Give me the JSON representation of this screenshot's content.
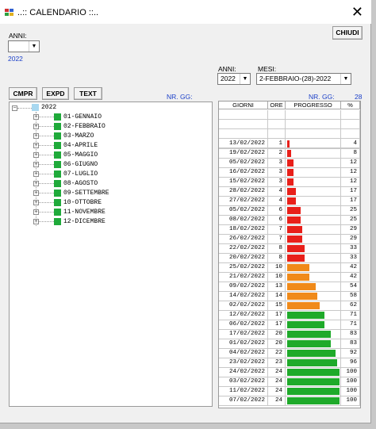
{
  "window": {
    "title": "..:: CALENDARIO ::..",
    "close_glyph": "✕"
  },
  "toolbar": {
    "chiudi_label": "CHIUDI",
    "cmpr_label": "CMPR",
    "expd_label": "EXPD",
    "text_label": "TEXT"
  },
  "filters": {
    "anni_label_left": "ANNI:",
    "anni_value_left": "",
    "year_text": "2022",
    "anni_label": "ANNI:",
    "anni_value": "2022",
    "mesi_label": "MESI:",
    "mesi_value": "2-FEBBRAIO-(28)-2022",
    "nr_gg_left": "NR. GG:",
    "nr_gg_right": "NR. GG:",
    "nr_gg_value": "28"
  },
  "tree": {
    "root": "2022",
    "months": [
      "01-GENNAIO",
      "02-FEBBRAIO",
      "03-MARZO",
      "04-APRILE",
      "05-MAGGIO",
      "06-GIUGNO",
      "07-LUGLIO",
      "08-AGOSTO",
      "09-SETTEMBRE",
      "10-OTTOBRE",
      "11-NOVEMBRE",
      "12-DICEMBRE"
    ],
    "colors": {
      "root": "#a8d8f0",
      "month": "#1faa3a"
    }
  },
  "grid": {
    "headers": [
      "GIORNI",
      "ORE",
      "PROGRESSO",
      "%"
    ],
    "rows": [
      {
        "date": "13/02/2022",
        "ore": "1",
        "pct": "4"
      },
      {
        "date": "19/02/2022",
        "ore": "2",
        "pct": "8"
      },
      {
        "date": "05/02/2022",
        "ore": "3",
        "pct": "12"
      },
      {
        "date": "16/02/2022",
        "ore": "3",
        "pct": "12"
      },
      {
        "date": "15/02/2022",
        "ore": "3",
        "pct": "12"
      },
      {
        "date": "28/02/2022",
        "ore": "4",
        "pct": "17"
      },
      {
        "date": "27/02/2022",
        "ore": "4",
        "pct": "17"
      },
      {
        "date": "05/02/2022",
        "ore": "6",
        "pct": "25"
      },
      {
        "date": "08/02/2022",
        "ore": "6",
        "pct": "25"
      },
      {
        "date": "18/02/2022",
        "ore": "7",
        "pct": "29"
      },
      {
        "date": "26/02/2022",
        "ore": "7",
        "pct": "29"
      },
      {
        "date": "22/02/2022",
        "ore": "8",
        "pct": "33"
      },
      {
        "date": "20/02/2022",
        "ore": "8",
        "pct": "33"
      },
      {
        "date": "25/02/2022",
        "ore": "10",
        "pct": "42"
      },
      {
        "date": "21/02/2022",
        "ore": "10",
        "pct": "42"
      },
      {
        "date": "09/02/2022",
        "ore": "13",
        "pct": "54"
      },
      {
        "date": "14/02/2022",
        "ore": "14",
        "pct": "58"
      },
      {
        "date": "02/02/2022",
        "ore": "15",
        "pct": "62"
      },
      {
        "date": "12/02/2022",
        "ore": "17",
        "pct": "71"
      },
      {
        "date": "06/02/2022",
        "ore": "17",
        "pct": "71"
      },
      {
        "date": "17/02/2022",
        "ore": "20",
        "pct": "83"
      },
      {
        "date": "01/02/2022",
        "ore": "20",
        "pct": "83"
      },
      {
        "date": "04/02/2022",
        "ore": "22",
        "pct": "92"
      },
      {
        "date": "23/02/2022",
        "ore": "23",
        "pct": "96"
      },
      {
        "date": "24/02/2022",
        "ore": "24",
        "pct": "100"
      },
      {
        "date": "03/02/2022",
        "ore": "24",
        "pct": "100"
      },
      {
        "date": "11/02/2022",
        "ore": "24",
        "pct": "100"
      },
      {
        "date": "07/02/2022",
        "ore": "24",
        "pct": "100"
      }
    ],
    "colors": {
      "low": "#e8201a",
      "mid": "#f08a1a",
      "high": "#1faa2a"
    }
  }
}
